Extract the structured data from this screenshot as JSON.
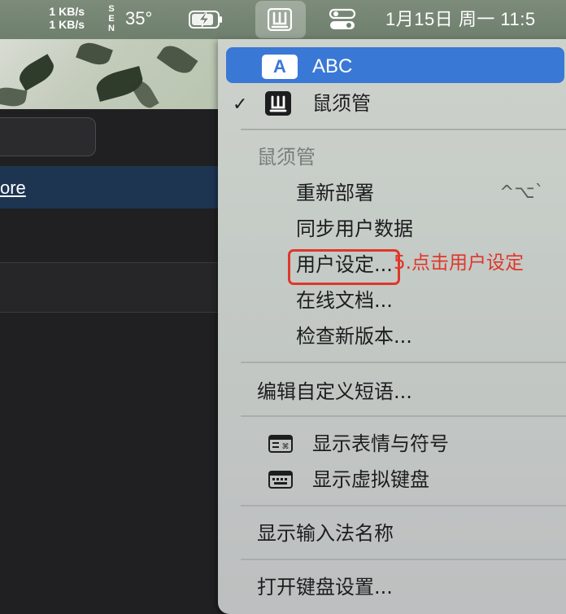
{
  "menubar": {
    "net_up": "1 KB/s",
    "net_down": "1 KB/s",
    "sensor_letters": [
      "S",
      "E",
      "N"
    ],
    "temperature": "35°",
    "battery_icon": "battery-charging-icon",
    "ime_icon": "shuxuguan-icon",
    "control_center_icon": "control-center-icon",
    "clock": "1月15日 周一 11:5"
  },
  "background": {
    "link_text": "ore"
  },
  "menu": {
    "abc_badge": "A",
    "abc_label": "ABC",
    "checkmark": "✓",
    "ime_label": "鼠须管",
    "section_title": "鼠须管",
    "items": {
      "redeploy": "重新部署",
      "redeploy_shortcut": "^⌥`",
      "sync": "同步用户数据",
      "user_settings": "用户设定...",
      "online_docs": "在线文档...",
      "check_update": "检查新版本..."
    },
    "edit_phrases": "编辑自定义短语...",
    "emoji": "显示表情与符号",
    "virtual_keyboard": "显示虚拟键盘",
    "show_ime_name": "显示输入法名称",
    "open_keyboard_settings": "打开键盘设置..."
  },
  "annotation": {
    "text": "5.点击用户设定",
    "color": "#e0362b"
  },
  "colors": {
    "highlight": "#3a78d6",
    "menu_bg": "#c8cdc8"
  }
}
